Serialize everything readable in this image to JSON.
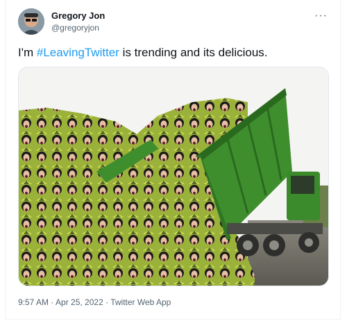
{
  "tweet": {
    "author_name": "Gregory Jon",
    "author_handle": "@gregoryjon",
    "more_icon": "more-dots-icon",
    "text_before": "I'm ",
    "hashtag": "#LeavingTwitter",
    "text_after": " is trending and its delicious.",
    "timestamp": "9:57 AM · Apr 25, 2022 · Twitter Web App"
  },
  "media": {
    "description_colors": {
      "truck": "#3f8e2e",
      "truck_dark": "#2a6a1e",
      "sky": "#f4f4f2",
      "ground": "#6b6a62"
    }
  }
}
